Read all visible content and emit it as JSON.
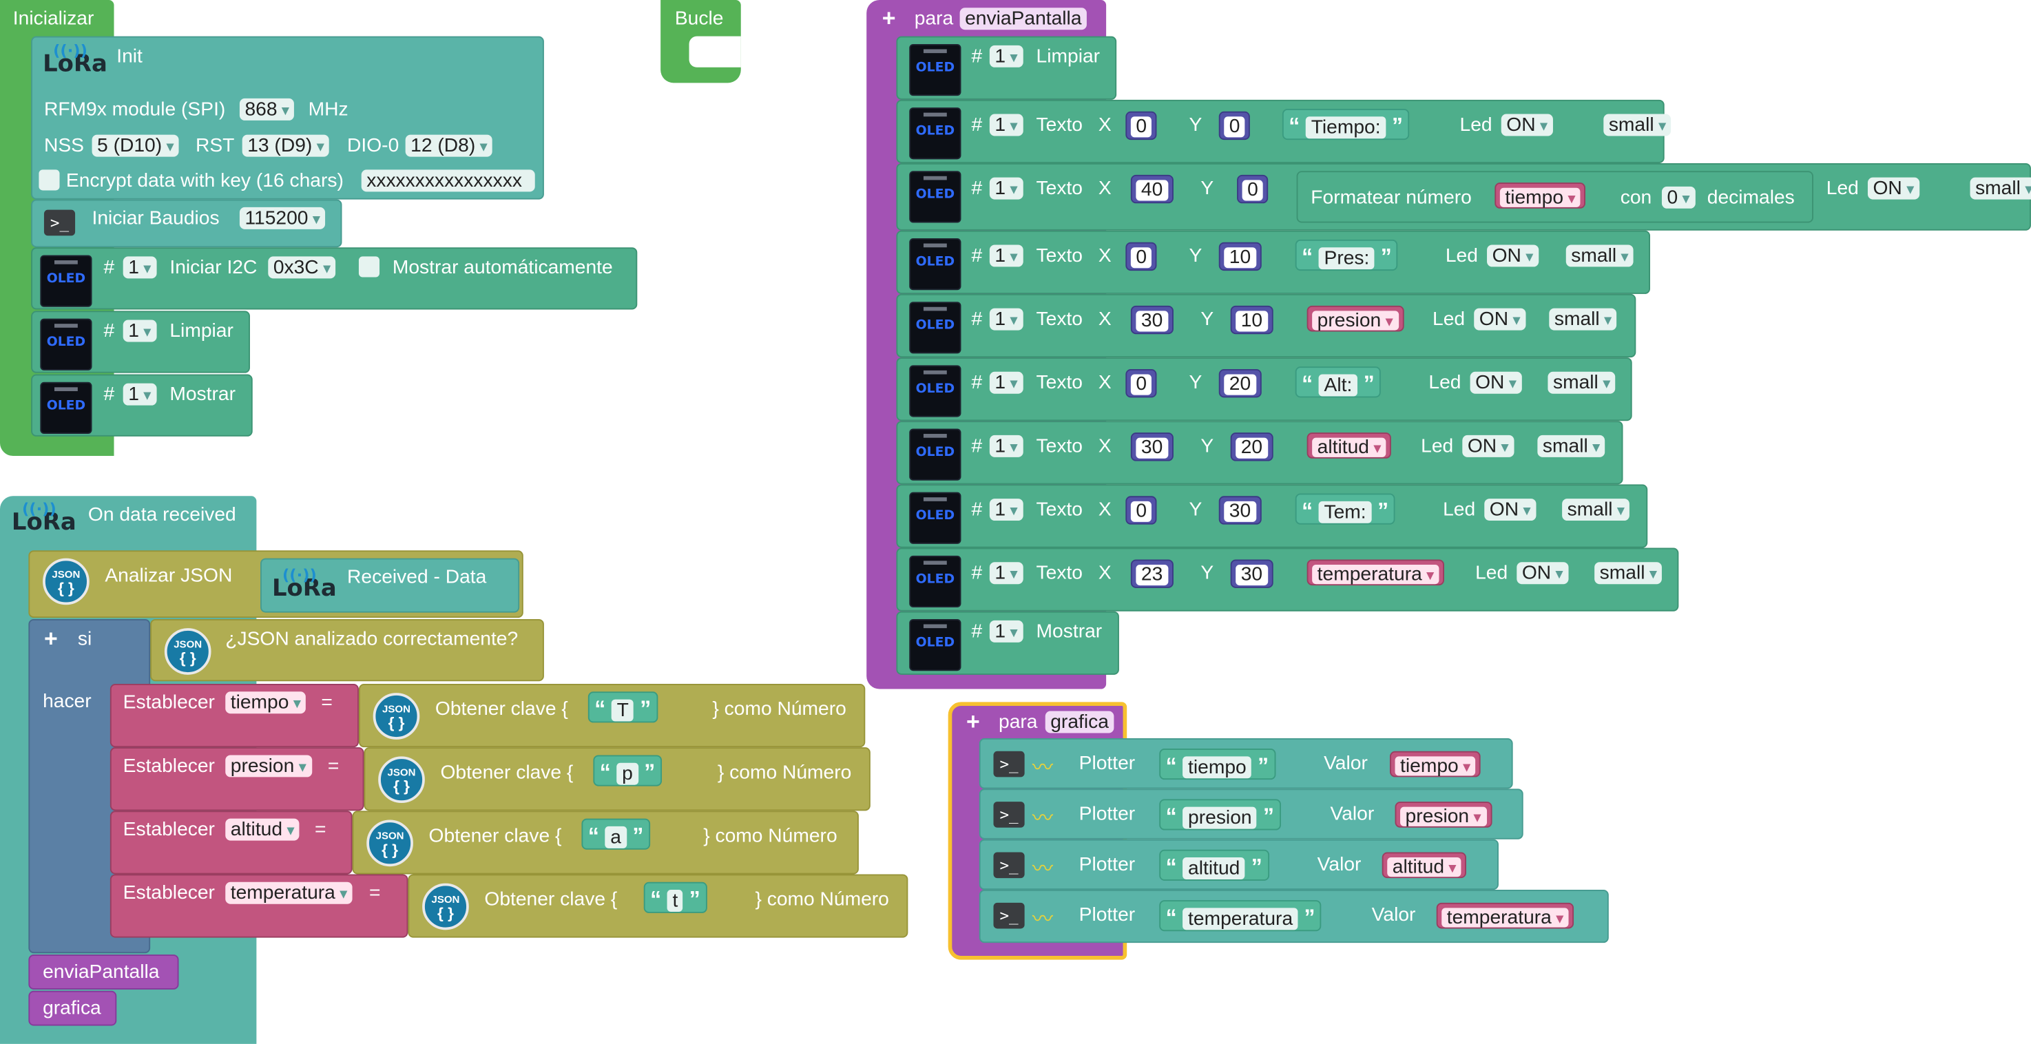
{
  "init": {
    "hat": "Inicializar",
    "lora_title": "Init",
    "module_label": "RFM9x module (SPI)",
    "freq": "868",
    "freq_unit": "MHz",
    "nss_label": "NSS",
    "nss": "5 (D10)",
    "rst_label": "RST",
    "rst": "13 (D9)",
    "dio_label": "DIO-0",
    "dio": "12 (D8)",
    "encrypt_label": "Encrypt data with key (16 chars)",
    "encrypt_key": "xxxxxxxxxxxxxxxx",
    "serial_label": "Iniciar  Baudios",
    "baud": "115200",
    "i2c_label": "Iniciar I2C",
    "i2c_addr": "0x3C",
    "auto_show": "Mostrar automáticamente",
    "clear_label": "Limpiar",
    "show_label": "Mostrar",
    "display_num": "1"
  },
  "loop": {
    "hat": "Bucle"
  },
  "received": {
    "hat": "On data received",
    "parse_label": "Analizar JSON",
    "data_label": "Received - Data",
    "if_label": "si",
    "cond_label": "¿JSON analizado correctamente?",
    "do_label": "hacer",
    "set_label": "Establecer",
    "get_label": "Obtener clave {",
    "as_number": "} como Número",
    "assignments": [
      {
        "var": "tiempo",
        "key": "T"
      },
      {
        "var": "presion",
        "key": "p"
      },
      {
        "var": "altitud",
        "key": "a"
      },
      {
        "var": "temperatura",
        "key": "t"
      }
    ],
    "calls": [
      "enviaPantalla",
      "grafica"
    ]
  },
  "envia": {
    "for_label": "para",
    "name": "enviaPantalla",
    "hash": "#",
    "display_num": "1",
    "clear_label": "Limpiar",
    "text_label": "Texto",
    "x_label": "X",
    "y_label": "Y",
    "led_label": "Led",
    "led": "ON",
    "size": "small",
    "format_label": "Formatear número",
    "with_label": "con",
    "decimals": "0",
    "decimals_label": "decimales",
    "show_label": "Mostrar",
    "rows": [
      {
        "x": "0",
        "y": "0",
        "kind": "text",
        "value": "Tiempo:"
      },
      {
        "x": "40",
        "y": "0",
        "kind": "format",
        "value": "tiempo"
      },
      {
        "x": "0",
        "y": "10",
        "kind": "text",
        "value": "Pres:"
      },
      {
        "x": "30",
        "y": "10",
        "kind": "var",
        "value": "presion"
      },
      {
        "x": "0",
        "y": "20",
        "kind": "text",
        "value": "Alt:"
      },
      {
        "x": "30",
        "y": "20",
        "kind": "var",
        "value": "altitud"
      },
      {
        "x": "0",
        "y": "30",
        "kind": "text",
        "value": "Tem:"
      },
      {
        "x": "23",
        "y": "30",
        "kind": "var",
        "value": "temperatura"
      }
    ]
  },
  "grafica": {
    "for_label": "para",
    "name": "grafica",
    "plotter_label": "Plotter",
    "value_label": "Valor",
    "rows": [
      {
        "name": "tiempo",
        "var": "tiempo"
      },
      {
        "name": "presion",
        "var": "presion"
      },
      {
        "name": "altitud",
        "var": "altitud"
      },
      {
        "name": "temperatura",
        "var": "temperatura"
      }
    ]
  },
  "icons": {
    "oled": "OLED",
    "lora": "LoRa",
    "json": "JSON",
    "json_braces": "{ }"
  },
  "colors": {
    "event": "#56b356",
    "lora": "#5ab4a8",
    "oled": "#4eae8b",
    "procedure": "#a352b4",
    "logic": "#b0ad52",
    "json_set": "#c2557f",
    "loop_blue": "#5b80a5",
    "highlight": "#f7c130"
  }
}
